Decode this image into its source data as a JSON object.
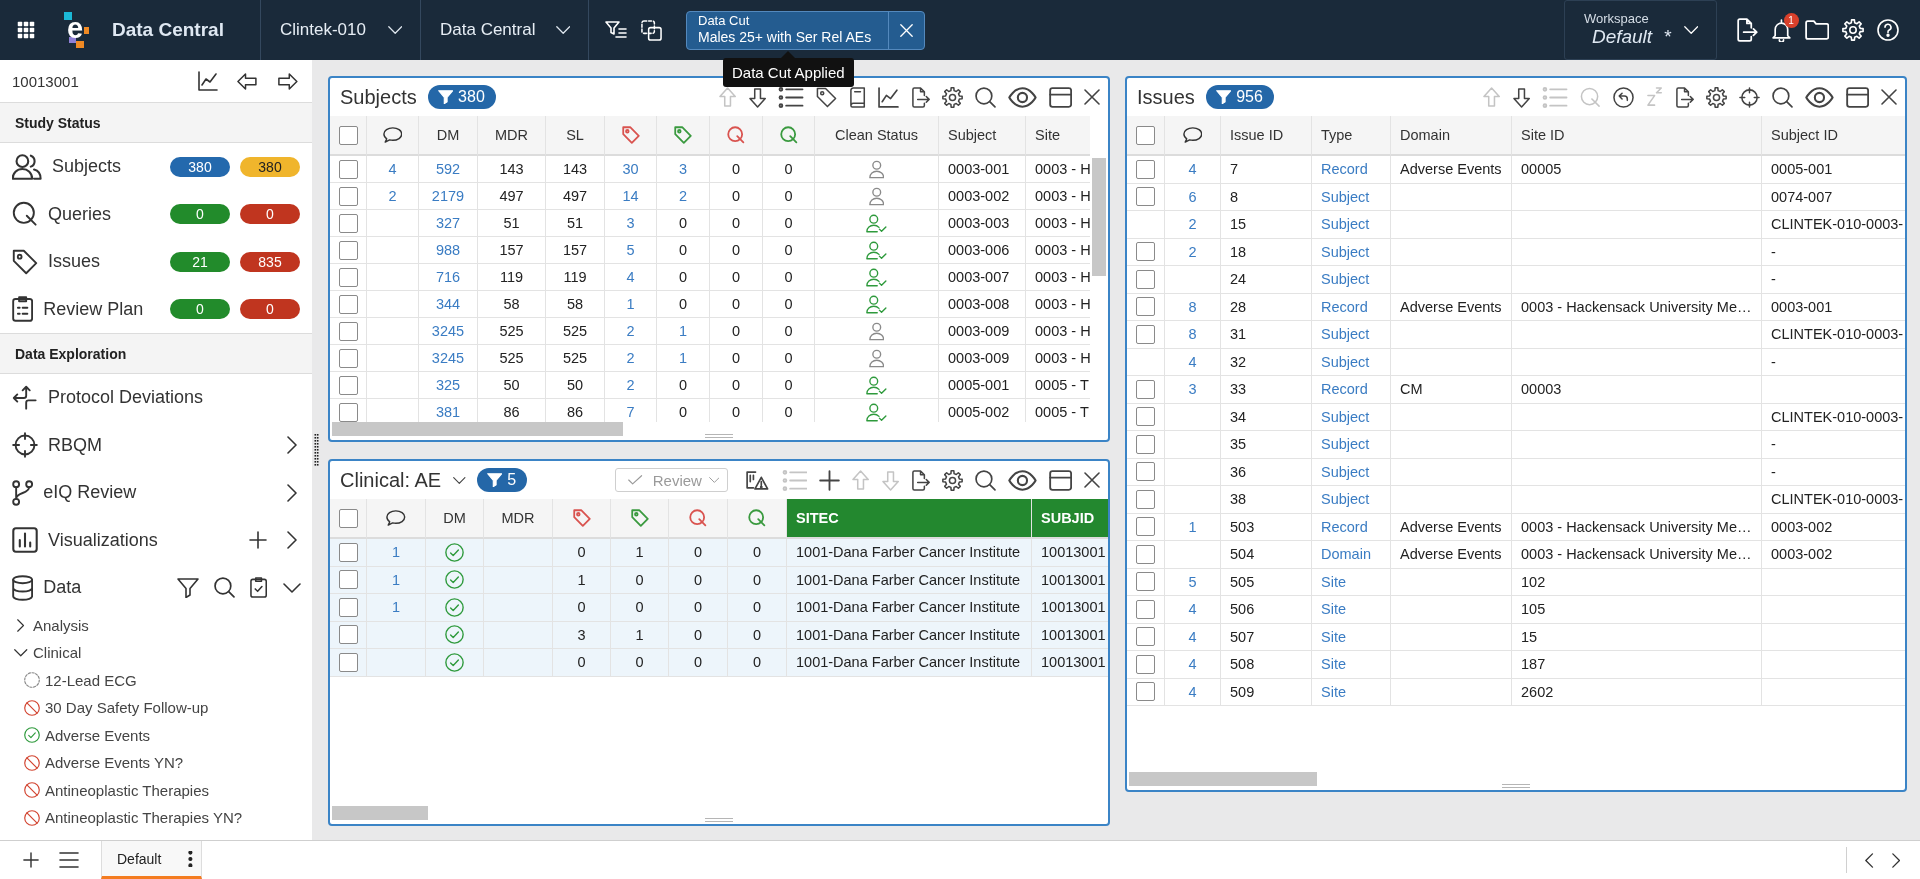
{
  "top_bar": {
    "logo_letter": "e",
    "app_name": "Data Central",
    "study": "Clintek-010",
    "module": "Data Central",
    "data_cut": {
      "label": "Data Cut",
      "value": "Males 25+ with Ser Rel AEs",
      "tooltip": "Data Cut Applied"
    },
    "workspace": {
      "label": "Workspace",
      "value": "Default",
      "unsaved_mark": "*"
    },
    "notification_count": "1"
  },
  "sidebar": {
    "record_id": "10013001",
    "study_status": {
      "title": "Study Status",
      "items": [
        {
          "kind": "subjects",
          "label": "Subjects",
          "counts": [
            {
              "value": "380",
              "color": "#2469ad"
            },
            {
              "value": "380",
              "color": "#f0b52c"
            }
          ]
        },
        {
          "kind": "queries",
          "label": "Queries",
          "counts": [
            {
              "value": "0",
              "color": "#228b2b"
            },
            {
              "value": "0",
              "color": "#c0351f"
            }
          ]
        },
        {
          "kind": "issues",
          "label": "Issues",
          "counts": [
            {
              "value": "21",
              "color": "#228b2b"
            },
            {
              "value": "835",
              "color": "#c0351f"
            }
          ]
        },
        {
          "kind": "review",
          "label": "Review Plan",
          "counts": [
            {
              "value": "0",
              "color": "#228b2b"
            },
            {
              "value": "0",
              "color": "#c0351f"
            }
          ]
        }
      ]
    },
    "data_exploration": {
      "title": "Data Exploration",
      "items": [
        {
          "kind": "deviations",
          "label": "Protocol Deviations"
        },
        {
          "kind": "rbqm",
          "label": "RBQM",
          "expanded": false
        },
        {
          "kind": "review",
          "label": "eIQ Review",
          "expanded": false
        },
        {
          "kind": "visualizations",
          "label": "Visualizations",
          "expanded": false,
          "actions": [
            {
              "kind": "add"
            }
          ]
        },
        {
          "kind": "data",
          "label": "Data",
          "expanded": true,
          "actions": [
            {
              "kind": "filter"
            },
            {
              "kind": "search"
            },
            {
              "kind": "checklist"
            }
          ],
          "children": [
            {
              "label": "Analysis",
              "expanded": false
            },
            {
              "label": "Clinical",
              "expanded": true,
              "children": [
                {
                  "label": "12-Lead ECG",
                  "kind": "pending"
                },
                {
                  "label": "30 Day Safety Follow-up",
                  "kind": "blocked"
                },
                {
                  "label": "Adverse Events",
                  "kind": "done"
                },
                {
                  "label": "Adverse Events YN?",
                  "kind": "blocked"
                },
                {
                  "label": "Antineoplastic Therapies",
                  "kind": "blocked"
                },
                {
                  "label": "Antineoplastic Therapies YN?",
                  "kind": "blocked"
                }
              ]
            }
          ]
        }
      ]
    }
  },
  "subjects_panel": {
    "title": "Subjects",
    "filter_count": "380",
    "toolbar": [
      {
        "kind": "up",
        "disabled": true
      },
      {
        "kind": "down",
        "disabled": false
      },
      {
        "kind": "list",
        "disabled": false
      },
      {
        "kind": "tag",
        "disabled": false
      },
      {
        "kind": "book",
        "disabled": false
      },
      {
        "kind": "chart",
        "disabled": false
      },
      {
        "kind": "export",
        "disabled": false
      },
      {
        "kind": "settings",
        "disabled": false
      },
      {
        "kind": "search",
        "disabled": false
      },
      {
        "kind": "view",
        "disabled": false
      },
      {
        "kind": "layout",
        "disabled": false
      },
      {
        "kind": "close",
        "disabled": false
      }
    ],
    "table": {
      "all_checked": false,
      "columns": [
        {
          "kind": "comment",
          "link": true
        },
        {
          "kind": "text",
          "label": "DM",
          "link": true
        },
        {
          "kind": "text",
          "label": "MDR",
          "link": false
        },
        {
          "kind": "text",
          "label": "SL",
          "link": false
        },
        {
          "kind": "tag",
          "color": "#d9534f",
          "link": true
        },
        {
          "kind": "tag",
          "color": "#3a9a3f"
        },
        {
          "kind": "query",
          "color": "#d9534f",
          "link": false
        },
        {
          "kind": "query",
          "color": "#3a9a3f",
          "link": false
        },
        {
          "kind": "clean",
          "label": "Clean Status"
        },
        {
          "kind": "text",
          "label": "Subject",
          "link": false
        },
        {
          "kind": "text",
          "label": "Site",
          "link": false
        }
      ],
      "rows": [
        {
          "checked": false,
          "cells": [
            "4",
            "592",
            "143",
            "143",
            "30",
            {
              "text": "3",
              "link": true
            },
            "0",
            "0",
            false,
            "0003-001",
            "0003 - H"
          ]
        },
        {
          "checked": false,
          "cells": [
            "2",
            "2179",
            "497",
            "497",
            "14",
            {
              "text": "2",
              "link": true
            },
            "0",
            "0",
            false,
            "0003-002",
            "0003 - H"
          ]
        },
        {
          "checked": false,
          "cells": [
            null,
            "327",
            "51",
            "51",
            "3",
            {
              "text": "0",
              "link": false
            },
            "0",
            "0",
            true,
            "0003-003",
            "0003 - H"
          ]
        },
        {
          "checked": false,
          "cells": [
            null,
            "988",
            "157",
            "157",
            "5",
            {
              "text": "0",
              "link": false
            },
            "0",
            "0",
            true,
            "0003-006",
            "0003 - H"
          ]
        },
        {
          "checked": false,
          "cells": [
            null,
            "716",
            "119",
            "119",
            "4",
            {
              "text": "0",
              "link": false
            },
            "0",
            "0",
            true,
            "0003-007",
            "0003 - H"
          ]
        },
        {
          "checked": false,
          "cells": [
            null,
            "344",
            "58",
            "58",
            "1",
            {
              "text": "0",
              "link": false
            },
            "0",
            "0",
            true,
            "0003-008",
            "0003 - H"
          ]
        },
        {
          "checked": false,
          "cells": [
            null,
            "3245",
            "525",
            "525",
            "2",
            {
              "text": "1",
              "link": true
            },
            "0",
            "0",
            false,
            "0003-009",
            "0003 - H"
          ]
        },
        {
          "checked": false,
          "cells": [
            null,
            "3245",
            "525",
            "525",
            "2",
            {
              "text": "1",
              "link": true
            },
            "0",
            "0",
            false,
            "0003-009",
            "0003 - H"
          ]
        },
        {
          "checked": false,
          "cells": [
            null,
            "325",
            "50",
            "50",
            "2",
            {
              "text": "0",
              "link": false
            },
            "0",
            "0",
            true,
            "0005-001",
            "0005 - T"
          ]
        },
        {
          "checked": false,
          "cells": [
            null,
            "381",
            "86",
            "86",
            "7",
            {
              "text": "0",
              "link": false
            },
            "0",
            "0",
            true,
            "0005-002",
            "0005 - T"
          ]
        }
      ]
    }
  },
  "clinical_panel": {
    "title": "Clinical: AE",
    "filter_count": "5",
    "review_button": {
      "label": "Review",
      "disabled": true
    },
    "toolbar": [
      {
        "kind": "warning",
        "disabled": false
      },
      {
        "kind": "list",
        "disabled": true
      },
      {
        "kind": "add",
        "disabled": false
      },
      {
        "kind": "up",
        "disabled": true
      },
      {
        "kind": "down",
        "disabled": true
      },
      {
        "kind": "export",
        "disabled": false
      },
      {
        "kind": "settings",
        "disabled": false
      },
      {
        "kind": "search",
        "disabled": false
      },
      {
        "kind": "view",
        "disabled": false
      },
      {
        "kind": "layout",
        "disabled": false
      },
      {
        "kind": "close",
        "disabled": false
      }
    ],
    "table": {
      "all_checked": false,
      "columns": [
        {
          "kind": "comment",
          "link": true,
          "highlighted": false
        },
        {
          "kind": "check",
          "label": "DM",
          "highlighted": false
        },
        {
          "kind": "text",
          "label": "MDR",
          "highlighted": false
        },
        {
          "kind": "tag",
          "color": "#d9534f",
          "link": false,
          "highlighted": false
        },
        {
          "kind": "tag",
          "color": "#3a9a3f",
          "link": false,
          "highlighted": false
        },
        {
          "kind": "query",
          "color": "#d9534f",
          "link": false,
          "highlighted": false
        },
        {
          "kind": "query",
          "color": "#3a9a3f",
          "link": false,
          "highlighted": false
        },
        {
          "kind": "text",
          "label": "SITEC",
          "link": false,
          "highlighted": true
        },
        {
          "kind": "text",
          "label": "SUBJID",
          "link": false,
          "highlighted": true
        }
      ],
      "rows": [
        {
          "checked": false,
          "highlighted": true,
          "cells": [
            "1",
            true,
            null,
            "0",
            "1",
            "0",
            "0",
            "1001-Dana Farber Cancer Institute",
            "10013001"
          ]
        },
        {
          "checked": false,
          "highlighted": true,
          "cells": [
            "1",
            true,
            null,
            "1",
            "0",
            "0",
            "0",
            "1001-Dana Farber Cancer Institute",
            "10013001"
          ]
        },
        {
          "checked": false,
          "highlighted": true,
          "cells": [
            "1",
            true,
            null,
            "0",
            "0",
            "0",
            "0",
            "1001-Dana Farber Cancer Institute",
            "10013001"
          ]
        },
        {
          "checked": false,
          "highlighted": true,
          "cells": [
            null,
            true,
            null,
            "3",
            "1",
            "0",
            "0",
            "1001-Dana Farber Cancer Institute",
            "10013001"
          ]
        },
        {
          "checked": false,
          "highlighted": true,
          "cells": [
            null,
            true,
            null,
            "0",
            "0",
            "0",
            "0",
            "1001-Dana Farber Cancer Institute",
            "10013001"
          ]
        }
      ]
    }
  },
  "issues_panel": {
    "title": "Issues",
    "filter_count": "956",
    "toolbar": [
      {
        "kind": "up",
        "disabled": true
      },
      {
        "kind": "down",
        "disabled": false
      },
      {
        "kind": "list",
        "disabled": true
      },
      {
        "kind": "query",
        "disabled": true
      },
      {
        "kind": "reply",
        "disabled": false
      },
      {
        "kind": "snooze",
        "disabled": true
      },
      {
        "kind": "export",
        "disabled": false
      },
      {
        "kind": "settings",
        "disabled": false
      },
      {
        "kind": "target",
        "disabled": false
      },
      {
        "kind": "search",
        "disabled": false
      },
      {
        "kind": "view",
        "disabled": false
      },
      {
        "kind": "layout",
        "disabled": false
      },
      {
        "kind": "close",
        "disabled": false
      }
    ],
    "table": {
      "all_checked": false,
      "columns": [
        {
          "kind": "comment",
          "link": true
        },
        {
          "kind": "text",
          "label": "Issue ID",
          "link": false
        },
        {
          "kind": "text",
          "label": "Type",
          "link": true
        },
        {
          "kind": "text",
          "label": "Domain",
          "link": false
        },
        {
          "kind": "text",
          "label": "Site ID",
          "link": false
        },
        {
          "kind": "text",
          "label": "Subject ID",
          "link": false
        }
      ],
      "rows": [
        {
          "checked": false,
          "cells": [
            "4",
            "7",
            "Record",
            "Adverse Events",
            "00005",
            "0005-001"
          ]
        },
        {
          "checked": false,
          "cells": [
            "6",
            "8",
            "Subject",
            null,
            null,
            "0074-007"
          ]
        },
        {
          "checked": null,
          "cells": [
            "2",
            "15",
            "Subject",
            null,
            null,
            "CLINTEK-010-0003-"
          ]
        },
        {
          "checked": false,
          "cells": [
            "2",
            "18",
            "Subject",
            null,
            null,
            "-"
          ]
        },
        {
          "checked": false,
          "cells": [
            null,
            "24",
            "Subject",
            null,
            null,
            "-"
          ]
        },
        {
          "checked": false,
          "cells": [
            "8",
            "28",
            "Record",
            "Adverse Events",
            "0003 - Hackensack University Me…",
            "0003-001"
          ]
        },
        {
          "checked": false,
          "cells": [
            "8",
            "31",
            "Subject",
            null,
            null,
            "CLINTEK-010-0003-"
          ]
        },
        {
          "checked": null,
          "cells": [
            "4",
            "32",
            "Subject",
            null,
            null,
            "-"
          ]
        },
        {
          "checked": false,
          "cells": [
            "3",
            "33",
            "Record",
            "CM",
            "00003",
            null
          ]
        },
        {
          "checked": false,
          "cells": [
            null,
            "34",
            "Subject",
            null,
            null,
            "CLINTEK-010-0003-"
          ]
        },
        {
          "checked": false,
          "cells": [
            null,
            "35",
            "Subject",
            null,
            null,
            "-"
          ]
        },
        {
          "checked": false,
          "cells": [
            null,
            "36",
            "Subject",
            null,
            null,
            "-"
          ]
        },
        {
          "checked": false,
          "cells": [
            null,
            "38",
            "Subject",
            null,
            null,
            "CLINTEK-010-0003-"
          ]
        },
        {
          "checked": false,
          "cells": [
            "1",
            "503",
            "Record",
            "Adverse Events",
            "0003 - Hackensack University Me…",
            "0003-002"
          ]
        },
        {
          "checked": false,
          "cells": [
            null,
            "504",
            "Domain",
            "Adverse Events",
            "0003 - Hackensack University Me…",
            "0003-002"
          ]
        },
        {
          "checked": false,
          "cells": [
            "5",
            "505",
            "Site",
            null,
            "102",
            null
          ]
        },
        {
          "checked": false,
          "cells": [
            "4",
            "506",
            "Site",
            null,
            "105",
            null
          ]
        },
        {
          "checked": false,
          "cells": [
            "4",
            "507",
            "Site",
            null,
            "15",
            null
          ]
        },
        {
          "checked": false,
          "cells": [
            "4",
            "508",
            "Site",
            null,
            "187",
            null
          ]
        },
        {
          "checked": false,
          "cells": [
            "4",
            "509",
            "Site",
            null,
            "2602",
            null
          ]
        }
      ]
    }
  },
  "bottom_bar": {
    "tabs": [
      {
        "label": "Default",
        "selected": true
      }
    ]
  }
}
